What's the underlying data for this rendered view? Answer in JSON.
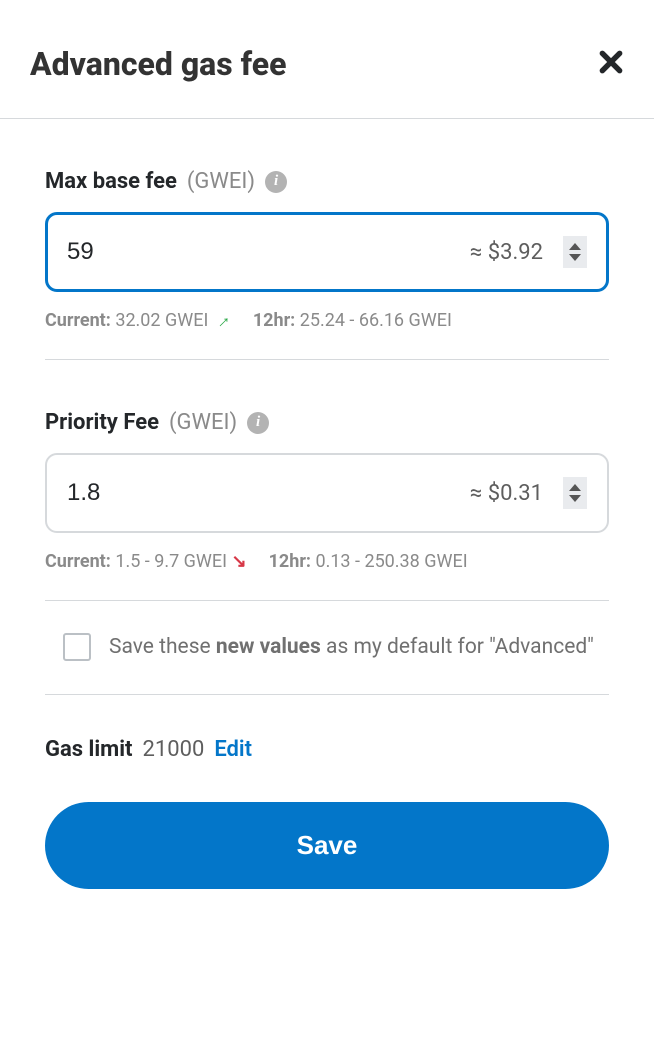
{
  "title": "Advanced gas fee",
  "maxBaseFee": {
    "label": "Max base fee",
    "unit": "(GWEI)",
    "value": "59",
    "usd": "≈ $3.92",
    "currentLabel": "Current:",
    "currentValue": "32.02 GWEI",
    "trend": "up",
    "twelveHrLabel": "12hr:",
    "twelveHrValue": "25.24 - 66.16 GWEI"
  },
  "priorityFee": {
    "label": "Priority Fee",
    "unit": "(GWEI)",
    "value": "1.8",
    "usd": "≈ $0.31",
    "currentLabel": "Current:",
    "currentValue": "1.5 - 9.7 GWEI",
    "trend": "down",
    "twelveHrLabel": "12hr:",
    "twelveHrValue": "0.13 - 250.38 GWEI"
  },
  "saveDefault": {
    "prefix": "Save these ",
    "bold": "new values",
    "suffix": " as my default for \"Advanced\""
  },
  "gasLimit": {
    "label": "Gas limit",
    "value": "21000",
    "editLabel": "Edit"
  },
  "saveButton": "Save"
}
